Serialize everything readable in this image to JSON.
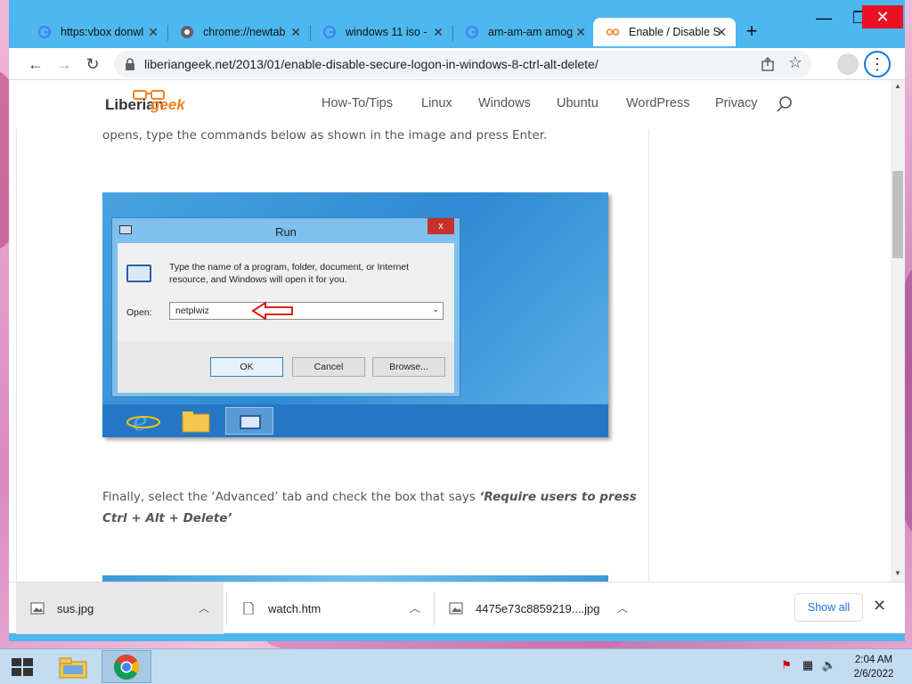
{
  "browser": {
    "tabs": [
      {
        "title": "https:vbox donwl",
        "favicon": "google-icon"
      },
      {
        "title": "chrome://newtab",
        "favicon": "chrome-icon"
      },
      {
        "title": "windows 11 iso -",
        "favicon": "google-icon"
      },
      {
        "title": "am-am-am amog",
        "favicon": "google-icon"
      },
      {
        "title": "Enable / Disable S",
        "favicon": "liberiangeek-icon",
        "active": true
      }
    ],
    "url": "liberiangeek.net/2013/01/enable-disable-secure-logon-in-windows-8-ctrl-alt-delete/"
  },
  "site": {
    "logo_part1": "Liberian",
    "logo_part2": "geek",
    "nav": [
      "How-To/Tips",
      "Linux",
      "Windows",
      "Ubuntu",
      "WordPress",
      "Privacy"
    ]
  },
  "article": {
    "para1": "opens, type the commands below as shown in the image and press Enter.",
    "para2_prefix": "Finally, select the ‘Advanced’ tab and check the box that says ",
    "para2_emph": "‘Require users to press Ctrl + Alt + Delete’"
  },
  "run_dialog": {
    "title": "Run",
    "close": "x",
    "description": "Type the name of a program, folder, document, or Internet resource, and Windows will open it for you.",
    "open_label": "Open:",
    "open_value": "netplwiz",
    "ok": "OK",
    "cancel": "Cancel",
    "browse": "Browse..."
  },
  "downloads": {
    "items": [
      "sus.jpg",
      "watch.htm",
      "4475e73c8859219....jpg"
    ],
    "show_all": "Show all"
  },
  "taskbar": {
    "time": "2:04 AM",
    "date": "2/6/2022"
  },
  "colors": {
    "accent": "#1a73e8",
    "titlebar": "#4cb8ef",
    "logo_orange": "#f58220",
    "close_red": "#e81123"
  }
}
